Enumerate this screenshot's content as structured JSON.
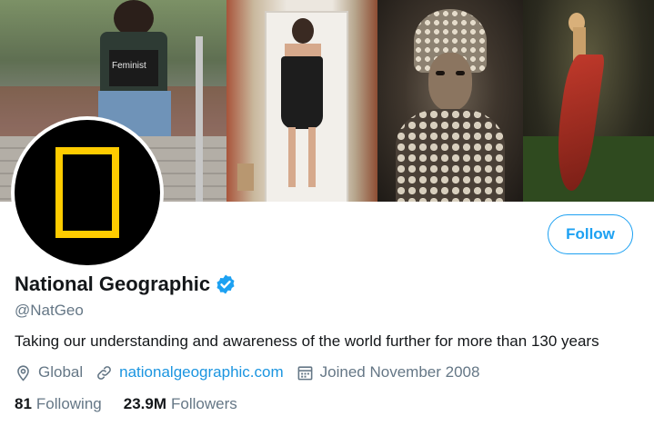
{
  "profile": {
    "name": "National Geographic",
    "handle": "@NatGeo",
    "verified": true,
    "bio": "Taking our understanding and awareness of the world further for more than 130 years",
    "location": "Global",
    "website": "nationalgeographic.com",
    "joined": "Joined November 2008"
  },
  "stats": {
    "following_count": "81",
    "following_label": "Following",
    "followers_count": "23.9M",
    "followers_label": "Followers"
  },
  "actions": {
    "follow_label": "Follow"
  },
  "banner": {
    "shirt_text": "Feminist"
  },
  "colors": {
    "accent": "#1da1f2",
    "link": "#1b95e0",
    "secondary_text": "#657786",
    "logo_yellow": "#ffcc00"
  },
  "icons": [
    "location-icon",
    "link-icon",
    "calendar-icon",
    "verified-badge-icon"
  ]
}
